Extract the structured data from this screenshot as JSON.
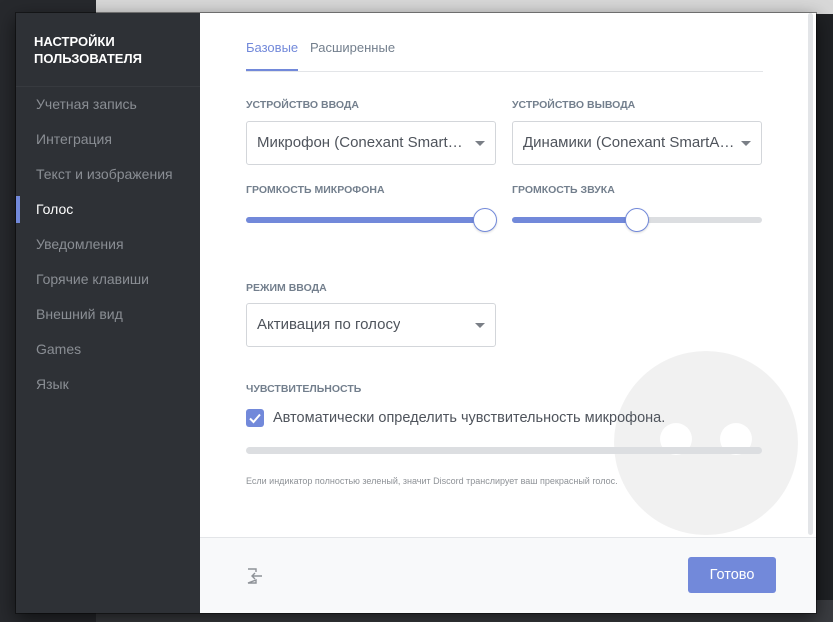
{
  "sidebar": {
    "title": "Настройки пользователя",
    "items": [
      {
        "label": "Учетная запись",
        "active": false
      },
      {
        "label": "Интеграция",
        "active": false
      },
      {
        "label": "Текст и изображения",
        "active": false
      },
      {
        "label": "Голос",
        "active": true
      },
      {
        "label": "Уведомления",
        "active": false
      },
      {
        "label": "Горячие клавиши",
        "active": false
      },
      {
        "label": "Внешний вид",
        "active": false
      },
      {
        "label": "Games",
        "active": false
      },
      {
        "label": "Язык",
        "active": false
      }
    ]
  },
  "tabs": [
    {
      "label": "Базовые",
      "active": true
    },
    {
      "label": "Расширенные",
      "active": false
    }
  ],
  "input_device": {
    "label": "Устройство ввода",
    "value": "Микрофон (Conexant Smart…"
  },
  "output_device": {
    "label": "Устройство вывода",
    "value": "Динамики (Conexant SmartA…"
  },
  "mic_volume": {
    "label": "Громкость микрофона",
    "percent": 100
  },
  "sound_volume": {
    "label": "Громкость звука",
    "percent": 50
  },
  "input_mode": {
    "label": "Режим ввода",
    "value": "Активация по голосу"
  },
  "sensitivity": {
    "label": "Чувствительность",
    "auto_checked": true,
    "auto_label": "Автоматически определить чувствительность микрофона.",
    "meter_percent": 0,
    "hint": "Если индикатор полностью зеленый, значит Discord транслирует ваш прекрасный голос."
  },
  "footer": {
    "done_label": "Готово",
    "logout_icon": "logout-icon"
  },
  "colors": {
    "accent": "#7289da",
    "sidebar_bg": "#2e3136",
    "content_bg": "#ffffff"
  }
}
